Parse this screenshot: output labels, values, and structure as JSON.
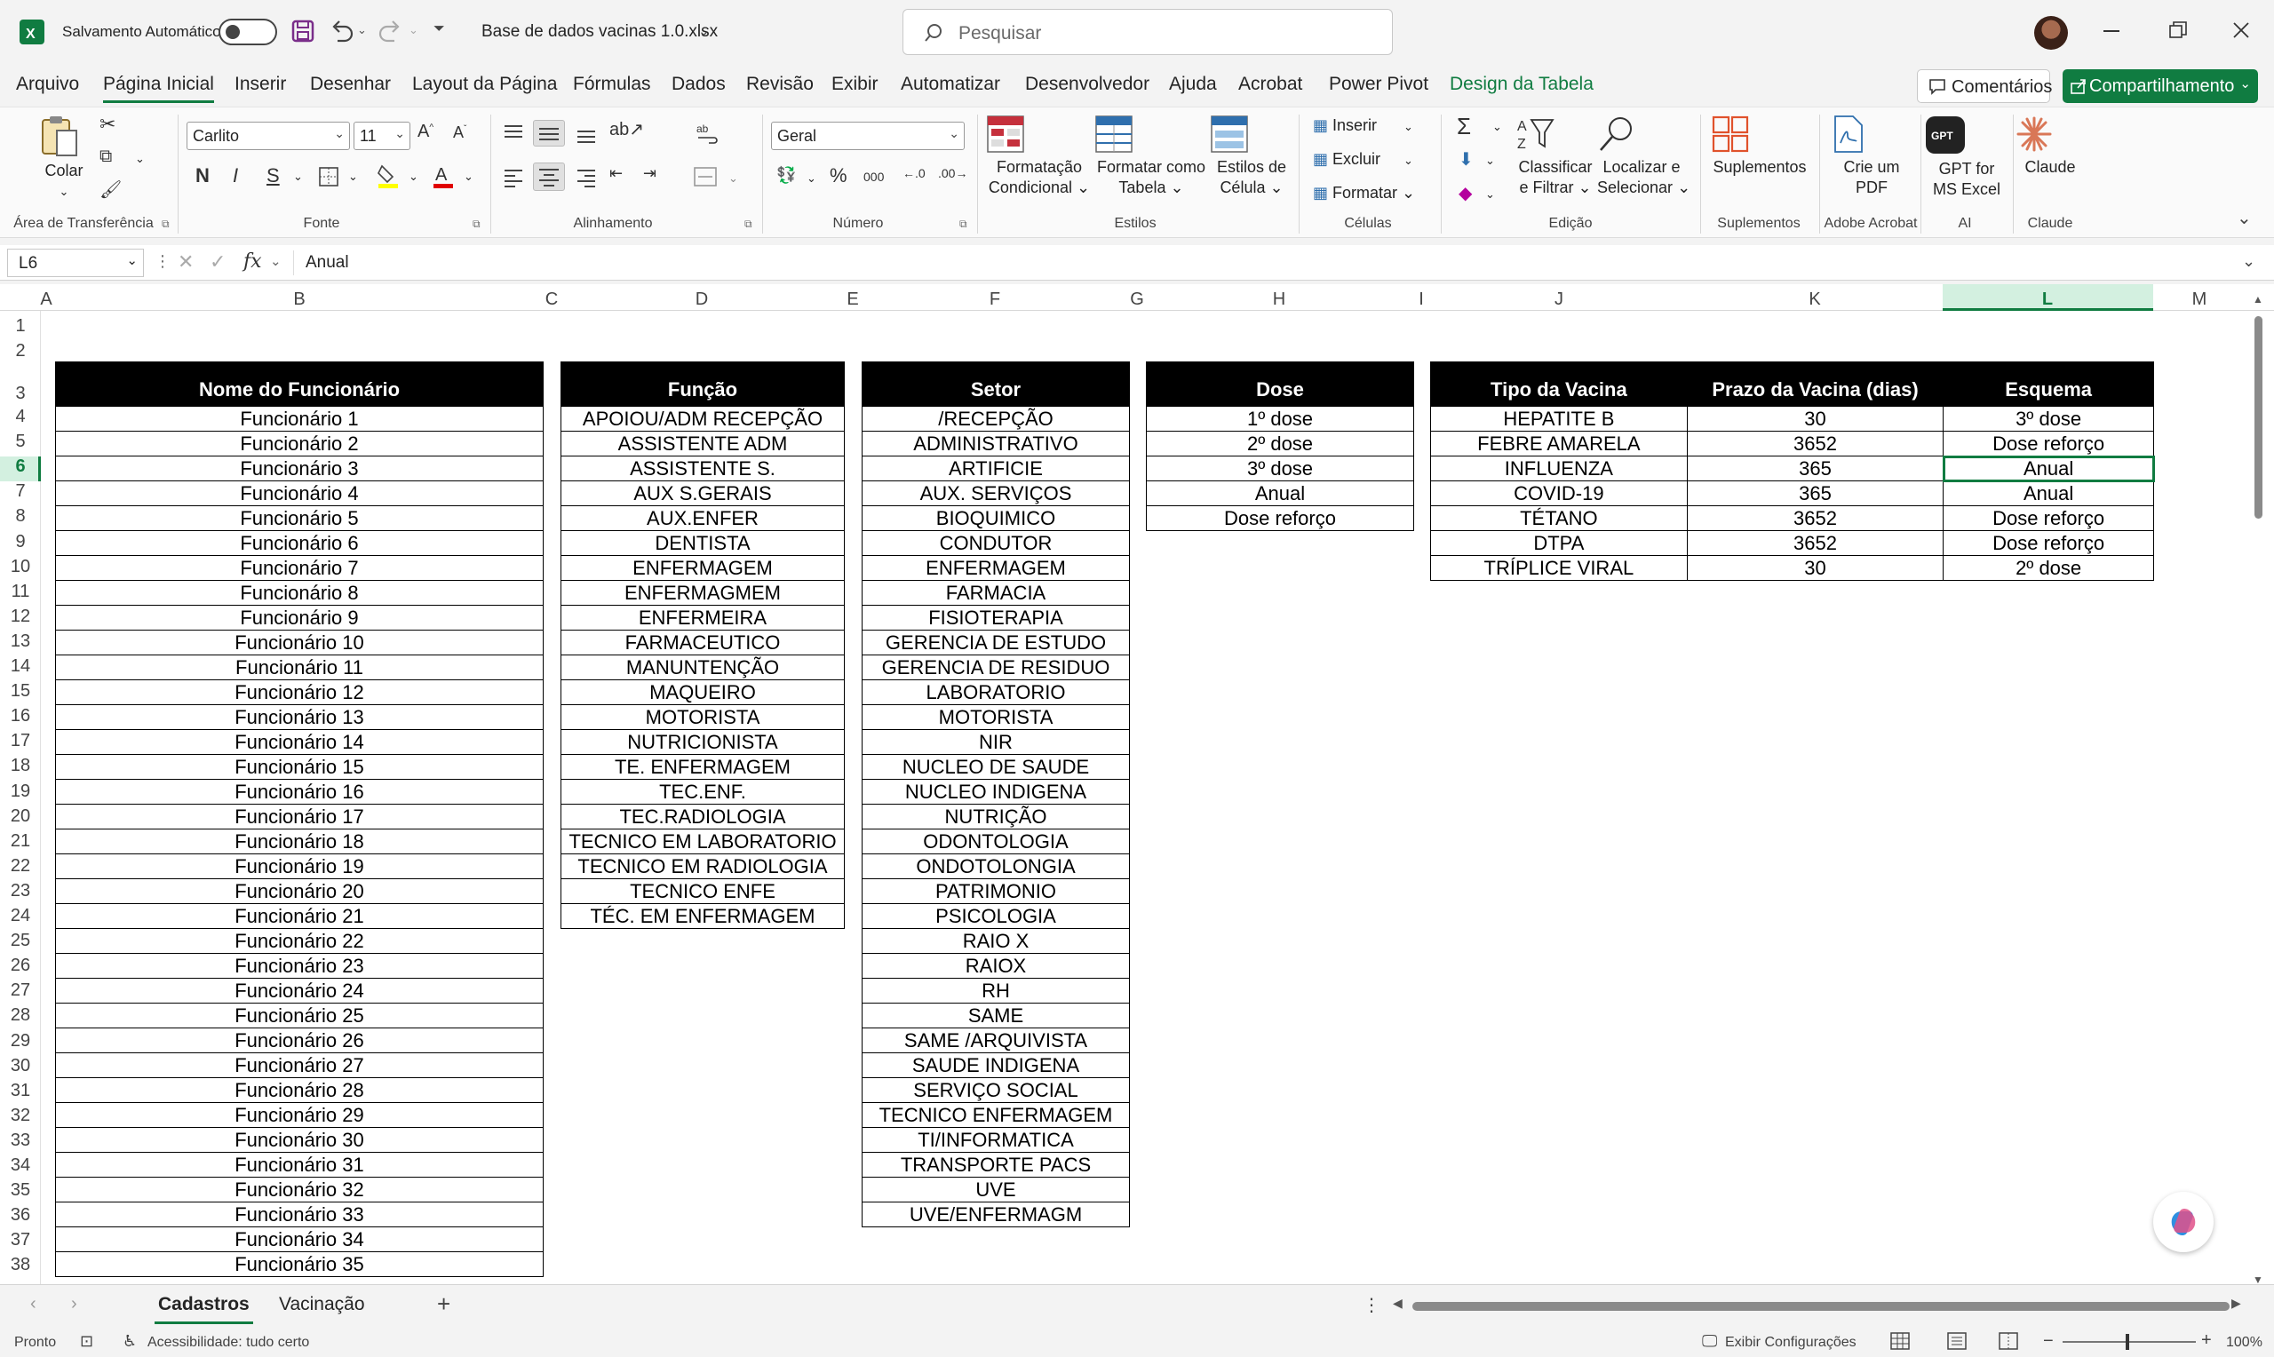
{
  "titlebar": {
    "autosave_label": "Salvamento Automático",
    "filename": "Base de dados vacinas 1.0.xlsx",
    "search_placeholder": "Pesquisar"
  },
  "menu": {
    "tabs": [
      "Arquivo",
      "Página Inicial",
      "Inserir",
      "Desenhar",
      "Layout da Página",
      "Fórmulas",
      "Dados",
      "Revisão",
      "Exibir",
      "Automatizar",
      "Desenvolvedor",
      "Ajuda",
      "Acrobat",
      "Power Pivot",
      "Design da Tabela"
    ],
    "active": "Página Inicial",
    "comments_label": "Comentários",
    "share_label": "Compartilhamento"
  },
  "ribbon": {
    "paste_label": "Colar",
    "font_name": "Carlito",
    "font_size": "11",
    "number_format": "Geral",
    "bold": "N",
    "italic": "I",
    "underline": "S",
    "cond_format": [
      "Formatação",
      "Condicional"
    ],
    "format_table": [
      "Formatar como",
      "Tabela"
    ],
    "cell_styles": [
      "Estilos de",
      "Célula"
    ],
    "insert": "Inserir",
    "delete": "Excluir",
    "format": "Formatar",
    "sort_filter": [
      "Classificar",
      "e Filtrar"
    ],
    "find_select": [
      "Localizar e",
      "Selecionar"
    ],
    "addins": "Suplementos",
    "create_pdf": [
      "Crie um",
      "PDF"
    ],
    "gpt": [
      "GPT for",
      "MS Excel"
    ],
    "claude": "Claude",
    "groups": {
      "clipboard": "Área de Transferência",
      "font": "Fonte",
      "alignment": "Alinhamento",
      "number": "Número",
      "styles": "Estilos",
      "cells": "Células",
      "editing": "Edição",
      "addins": "Suplementos",
      "acrobat": "Adobe Acrobat",
      "ai": "AI",
      "claude": "Claude"
    }
  },
  "formula_bar": {
    "cell_ref": "L6",
    "value": "Anual"
  },
  "columns": [
    "A",
    "B",
    "C",
    "D",
    "E",
    "F",
    "G",
    "H",
    "I",
    "J",
    "K",
    "L",
    "M"
  ],
  "rows": [
    "1",
    "2",
    "3",
    "4",
    "5",
    "6",
    "7",
    "8",
    "9",
    "10",
    "11",
    "12",
    "13",
    "14",
    "15",
    "16",
    "17",
    "18",
    "19",
    "20",
    "21",
    "22",
    "23",
    "24",
    "25",
    "26",
    "27",
    "28",
    "29",
    "30",
    "31",
    "32",
    "33",
    "34",
    "35",
    "36",
    "37",
    "38"
  ],
  "tables": {
    "funcionarios": {
      "header": "Nome do Funcionário",
      "items": [
        "Funcionário 1",
        "Funcionário 2",
        "Funcionário 3",
        "Funcionário 4",
        "Funcionário 5",
        "Funcionário 6",
        "Funcionário 7",
        "Funcionário 8",
        "Funcionário 9",
        "Funcionário 10",
        "Funcionário 11",
        "Funcionário 12",
        "Funcionário 13",
        "Funcionário 14",
        "Funcionário 15",
        "Funcionário 16",
        "Funcionário 17",
        "Funcionário 18",
        "Funcionário 19",
        "Funcionário 20",
        "Funcionário 21",
        "Funcionário 22",
        "Funcionário 23",
        "Funcionário 24",
        "Funcionário 25",
        "Funcionário 26",
        "Funcionário 27",
        "Funcionário 28",
        "Funcionário 29",
        "Funcionário 30",
        "Funcionário 31",
        "Funcionário 32",
        "Funcionário 33",
        "Funcionário 34",
        "Funcionário 35"
      ]
    },
    "funcao": {
      "header": "Função",
      "items": [
        "APOIOU/ADM RECEPÇÃO",
        "ASSISTENTE ADM",
        "ASSISTENTE S.",
        "AUX S.GERAIS",
        "AUX.ENFER",
        "DENTISTA",
        "ENFERMAGEM",
        "ENFERMAGMEM",
        "ENFERMEIRA",
        "FARMACEUTICO",
        "MANUNTENÇÃO",
        "MAQUEIRO",
        "MOTORISTA",
        "NUTRICIONISTA",
        "TE. ENFERMAGEM",
        "TEC.ENF.",
        "TEC.RADIOLOGIA",
        "TECNICO EM LABORATORIO",
        "TECNICO EM RADIOLOGIA",
        "TECNICO ENFE",
        "TÉC. EM ENFERMAGEM"
      ]
    },
    "setor": {
      "header": "Setor",
      "items": [
        "/RECEPÇÃO",
        "ADMINISTRATIVO",
        "ARTIFICIE",
        "AUX. SERVIÇOS",
        "BIOQUIMICO",
        "CONDUTOR",
        "ENFERMAGEM",
        "FARMACIA",
        "FISIOTERAPIA",
        "GERENCIA DE ESTUDO",
        "GERENCIA DE RESIDUO",
        "LABORATORIO",
        "MOTORISTA",
        "NIR",
        "NUCLEO DE SAUDE",
        "NUCLEO INDIGENA",
        "NUTRIÇÃO",
        "ODONTOLOGIA",
        "ONDOTOLONGIA",
        "PATRIMONIO",
        "PSICOLOGIA",
        "RAIO X",
        "RAIOX",
        "RH",
        "SAME",
        "SAME /ARQUIVISTA",
        "SAUDE INDIGENA",
        "SERVIÇO SOCIAL",
        "TECNICO ENFERMAGEM",
        "TI/INFORMATICA",
        "TRANSPORTE PACS",
        "UVE",
        "UVE/ENFERMAGM"
      ]
    },
    "dose": {
      "header": "Dose",
      "items": [
        "1º dose",
        "2º dose",
        "3º dose",
        "Anual",
        "Dose reforço"
      ]
    },
    "vacinas": {
      "headers": [
        "Tipo da Vacina",
        "Prazo da Vacina (dias)",
        "Esquema"
      ],
      "rows": [
        [
          "HEPATITE B",
          "30",
          "3º dose"
        ],
        [
          "FEBRE AMARELA",
          "3652",
          "Dose reforço"
        ],
        [
          "INFLUENZA",
          "365",
          "Anual"
        ],
        [
          "COVID-19",
          "365",
          "Anual"
        ],
        [
          "TÉTANO",
          "3652",
          "Dose reforço"
        ],
        [
          "DTPA",
          "3652",
          "Dose reforço"
        ],
        [
          "TRÍPLICE VIRAL",
          "30",
          "2º dose"
        ]
      ]
    }
  },
  "sheet_tabs": [
    "Cadastros",
    "Vacinação"
  ],
  "active_sheet": "Cadastros",
  "status": {
    "ready": "Pronto",
    "accessibility": "Acessibilidade: tudo certo",
    "display_settings": "Exibir Configurações",
    "zoom": "100%"
  },
  "colors": {
    "accent": "#107c41",
    "header_bg": "#000000"
  }
}
